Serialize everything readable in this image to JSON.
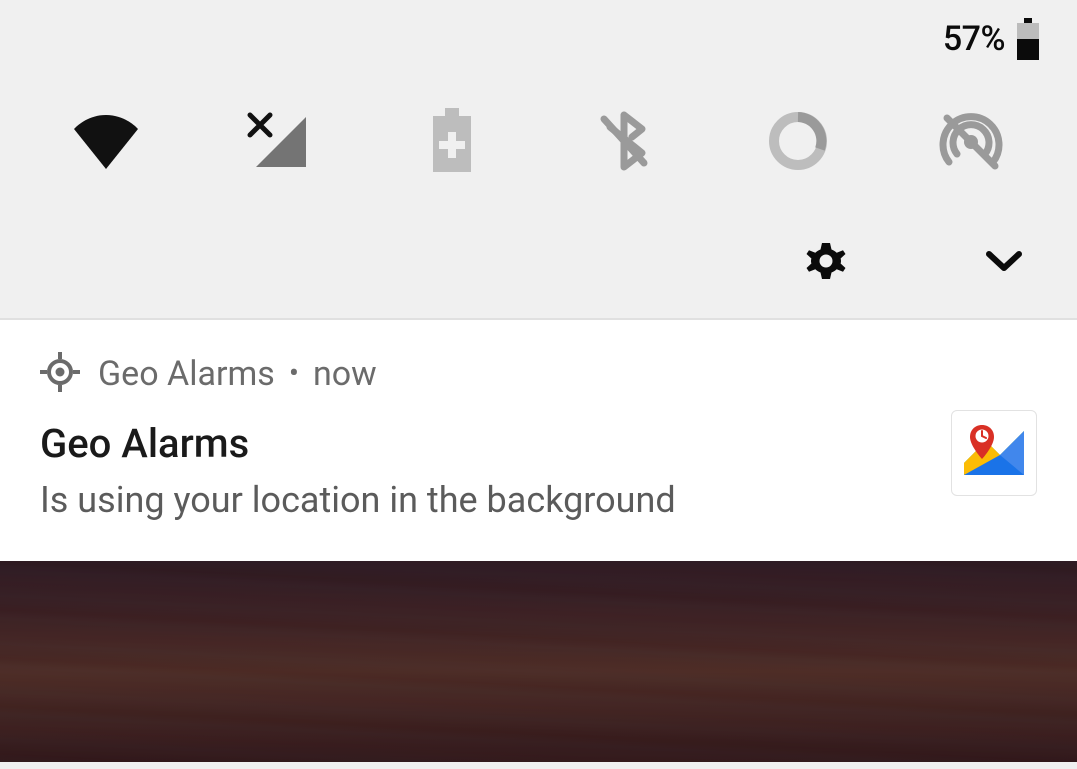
{
  "status": {
    "battery_percent": "57%",
    "battery_level": 0.57
  },
  "quick_tiles": {
    "wifi": "wifi-icon",
    "cellular": "cellular-no-sim-icon",
    "battery_saver": "battery-saver-icon",
    "bluetooth": "bluetooth-off-icon",
    "data": "data-usage-icon",
    "hotspot": "hotspot-off-icon"
  },
  "footer": {
    "settings": "gear-icon",
    "expand": "chevron-down-icon"
  },
  "notification": {
    "app_name": "Geo Alarms",
    "time": "now",
    "title": "Geo Alarms",
    "body": "Is using your location in the background",
    "app_icon": "location-target-icon",
    "large_icon": "map-pin-icon"
  }
}
